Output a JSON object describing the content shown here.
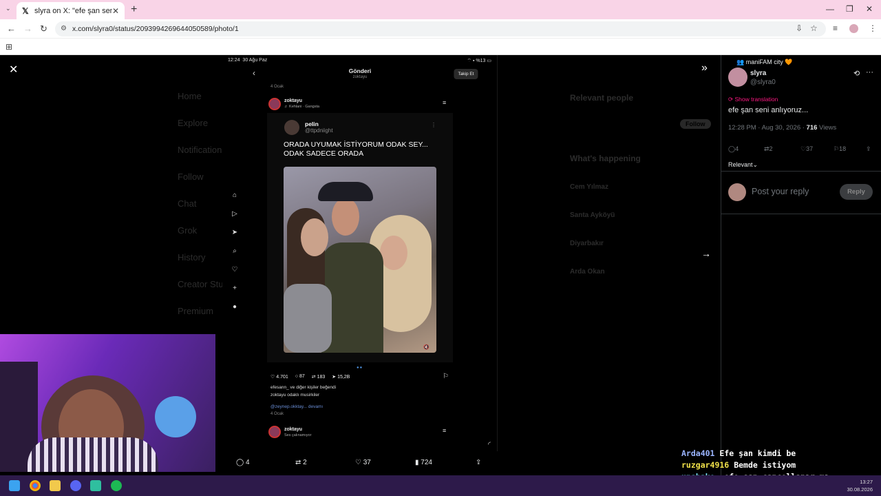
{
  "browser": {
    "tab_title": "slyra on X: \"efe şan seni anlıyoruz...\"",
    "url": "x.com/slyra0/status/2093994269644050589/photo/1"
  },
  "background": {
    "nav": [
      "Home",
      "Explore",
      "Notifications",
      "Follow",
      "Chat",
      "Grok",
      "History",
      "Creator Studio",
      "Premium"
    ],
    "relevant_people": "Relevant people",
    "follow": "Follow",
    "whats_happening": "What's happening",
    "trends": [
      "Cem Yılmaz",
      "Santa Ayköyü",
      "Diyarbakır",
      "Arda Okan"
    ]
  },
  "phone": {
    "time": "12:24",
    "date": "30 Ağu Paz",
    "battery": "%13",
    "header_title": "Gönderi",
    "header_sub": "zoktayu",
    "follow_btn": "Takip Et",
    "date_top": "4 Ocak",
    "post_user": "zoktayu",
    "post_music": "♬ Kehlani · Gangsta",
    "card_name": "pelin",
    "card_handle": "@ttpdniight",
    "card_text": "ORADA UYUMAK İSTİYORUM ODAK SEY... ODAK SADECE ORADA",
    "likes": "4.701",
    "comments": "87",
    "reposts": "183",
    "shares": "15,2B",
    "liked_by": "efesann_ ve diğer kişiler beğendi",
    "caption": "zoktayu odaklı musirkiler",
    "comment_preview": "@zeynep.okktay... devamı",
    "date_bottom": "4 Ocak",
    "post2_user": "zoktayu",
    "post2_sub": "Ses çalınamıyor"
  },
  "viewer_bar": {
    "replies": "4",
    "reposts": "2",
    "likes": "37",
    "views": "724"
  },
  "tweet": {
    "community": "maniFAM city 🧡",
    "name": "slyra",
    "handle": "@slyra0",
    "show_translation": "Show translation",
    "text": "efe şan seni anlıyoruz...",
    "time_date": "12:28 PM · Aug 30, 2026 · ",
    "views_count": "716",
    "views_label": " Views",
    "replies": "4",
    "reposts": "2",
    "likes": "37",
    "bookmarks": "18",
    "sort": "Relevant",
    "reply_placeholder": "Post your reply",
    "reply_button": "Reply"
  },
  "chat": [
    {
      "user": "Arda401",
      "msg": "Efe şan kimdi be"
    },
    {
      "user": "ruzgar4916",
      "msg": "Bemde istiyom"
    },
    {
      "user": "unshake…",
      "msg": "efe şan cancellanır mı"
    }
  ],
  "taskbar": {
    "time": "13:27",
    "date": "30.08.2026"
  }
}
